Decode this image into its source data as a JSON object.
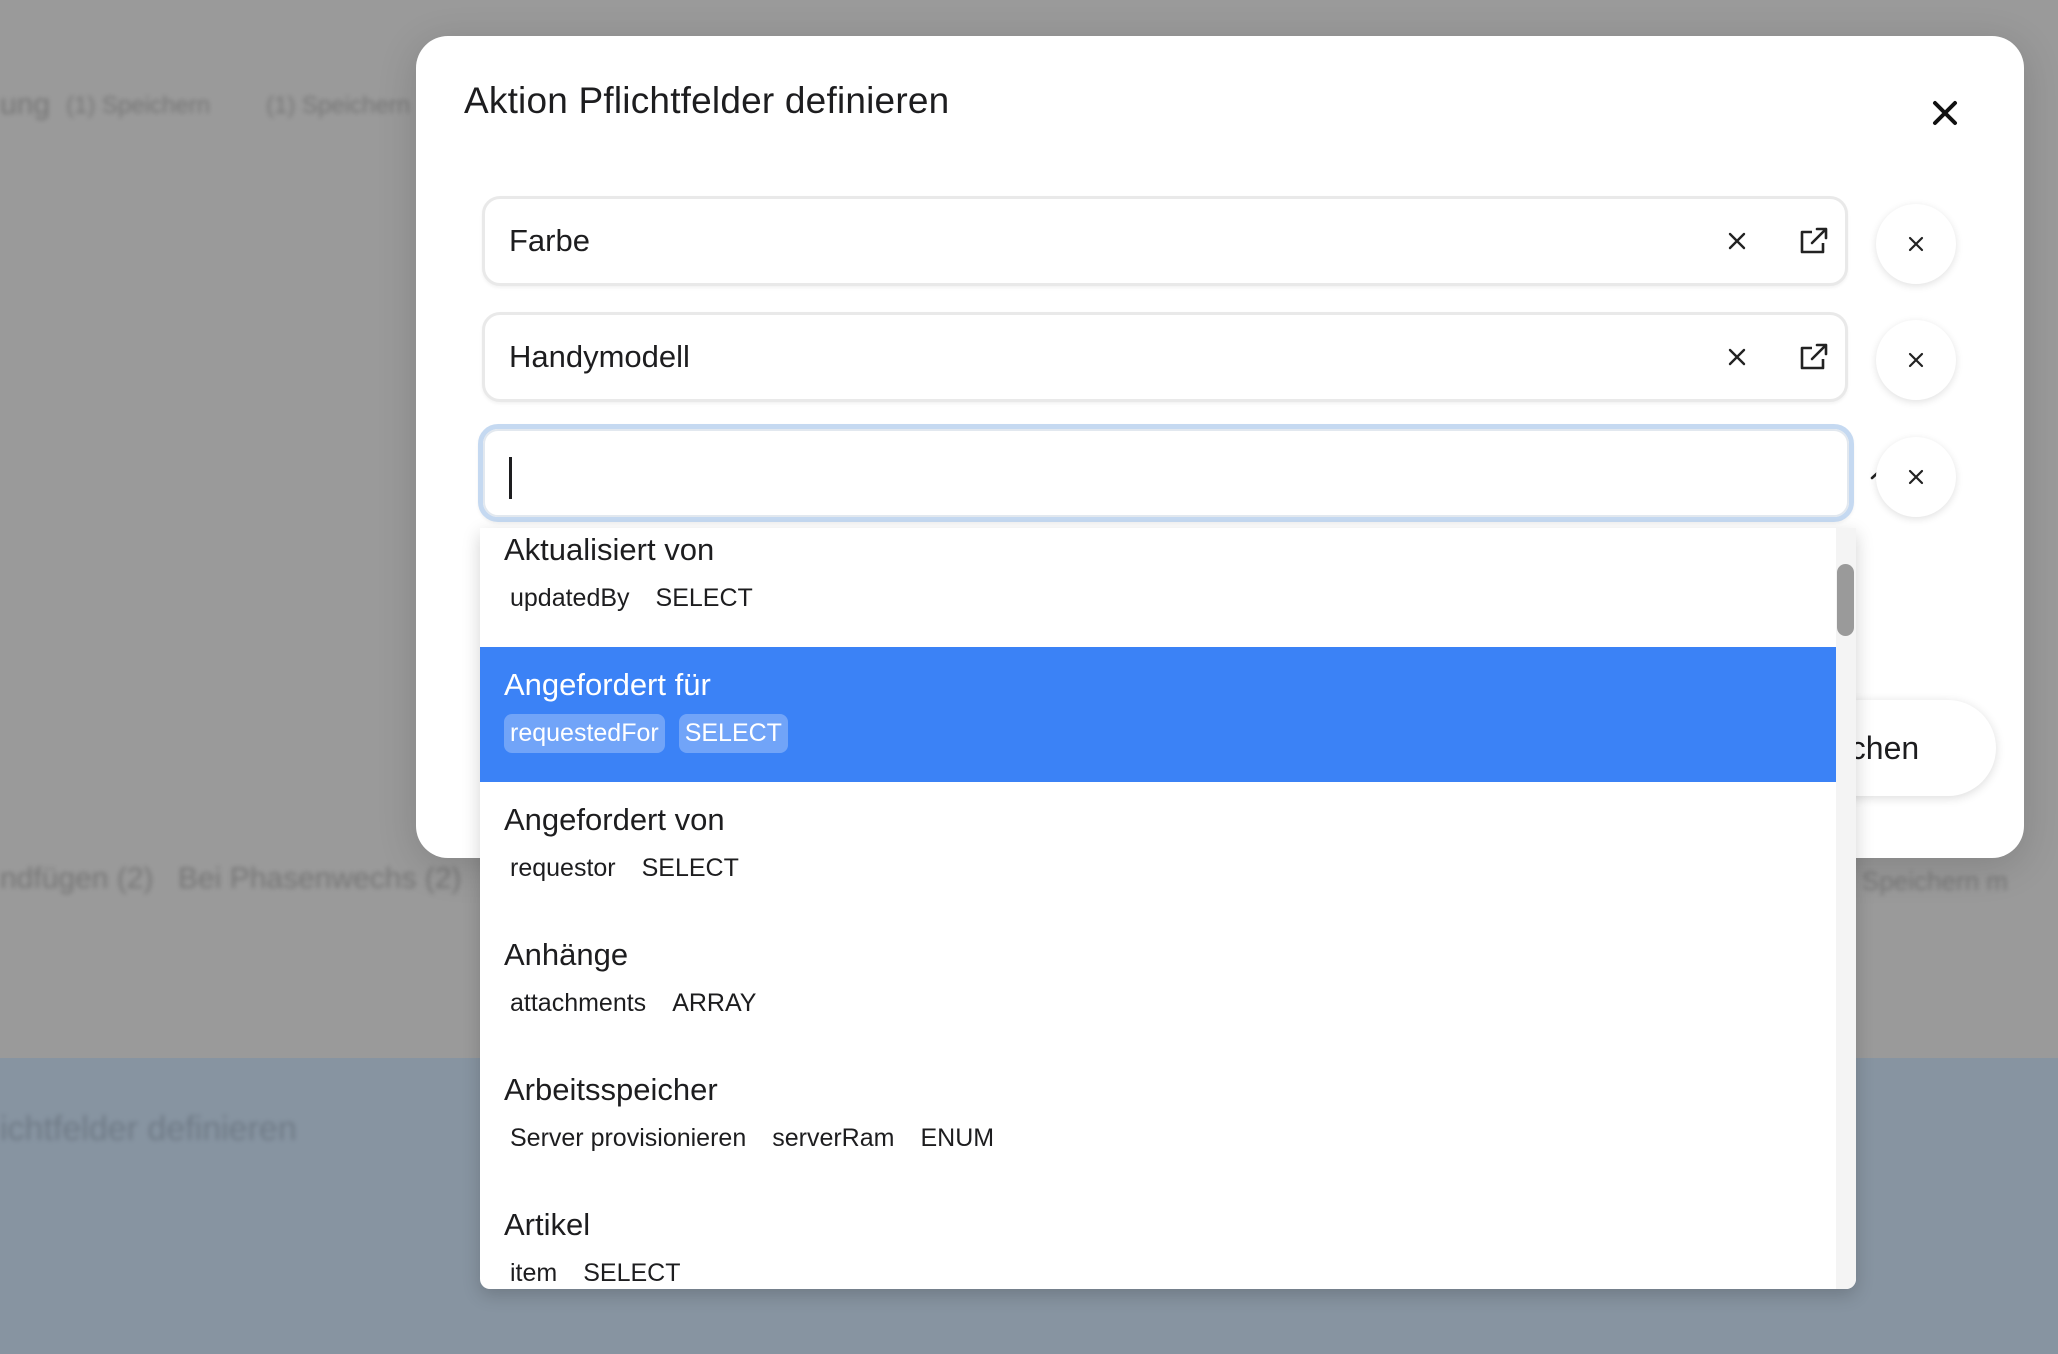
{
  "background": {
    "texts": [
      "ung",
      "(1) Speichern",
      "(1) Speichern",
      "ndfügen (2)",
      "Bei Phasenwechs (2)",
      "Speichern m",
      "ichtfelder definieren"
    ]
  },
  "modal": {
    "title": "Aktion Pflichtfelder definieren",
    "fields": [
      {
        "value": "Farbe"
      },
      {
        "value": "Handymodell"
      },
      {
        "value": ""
      }
    ],
    "cancel_label": "echen"
  },
  "dropdown": {
    "options": [
      {
        "label": "Aktualisiert von",
        "tags": [
          "updatedBy",
          "SELECT"
        ]
      },
      {
        "label": "Angefordert für",
        "tags": [
          "requestedFor",
          "SELECT"
        ],
        "active": true
      },
      {
        "label": "Angefordert von",
        "tags": [
          "requestor",
          "SELECT"
        ]
      },
      {
        "label": "Anhänge",
        "tags": [
          "attachments",
          "ARRAY"
        ]
      },
      {
        "label": "Arbeitsspeicher",
        "tags": [
          "Server provisionieren",
          "serverRam",
          "ENUM"
        ]
      },
      {
        "label": "Artikel",
        "tags": [
          "item",
          "SELECT"
        ]
      }
    ]
  },
  "colors": {
    "accent": "#3b82f6",
    "overlay": "#9a9a9a",
    "focus_ring": "#c5d9f1"
  },
  "icons": {
    "close": "close-icon",
    "clear": "clear-icon",
    "open": "external-link-icon",
    "expand": "chevron-down-icon",
    "collapse": "chevron-up-icon"
  }
}
